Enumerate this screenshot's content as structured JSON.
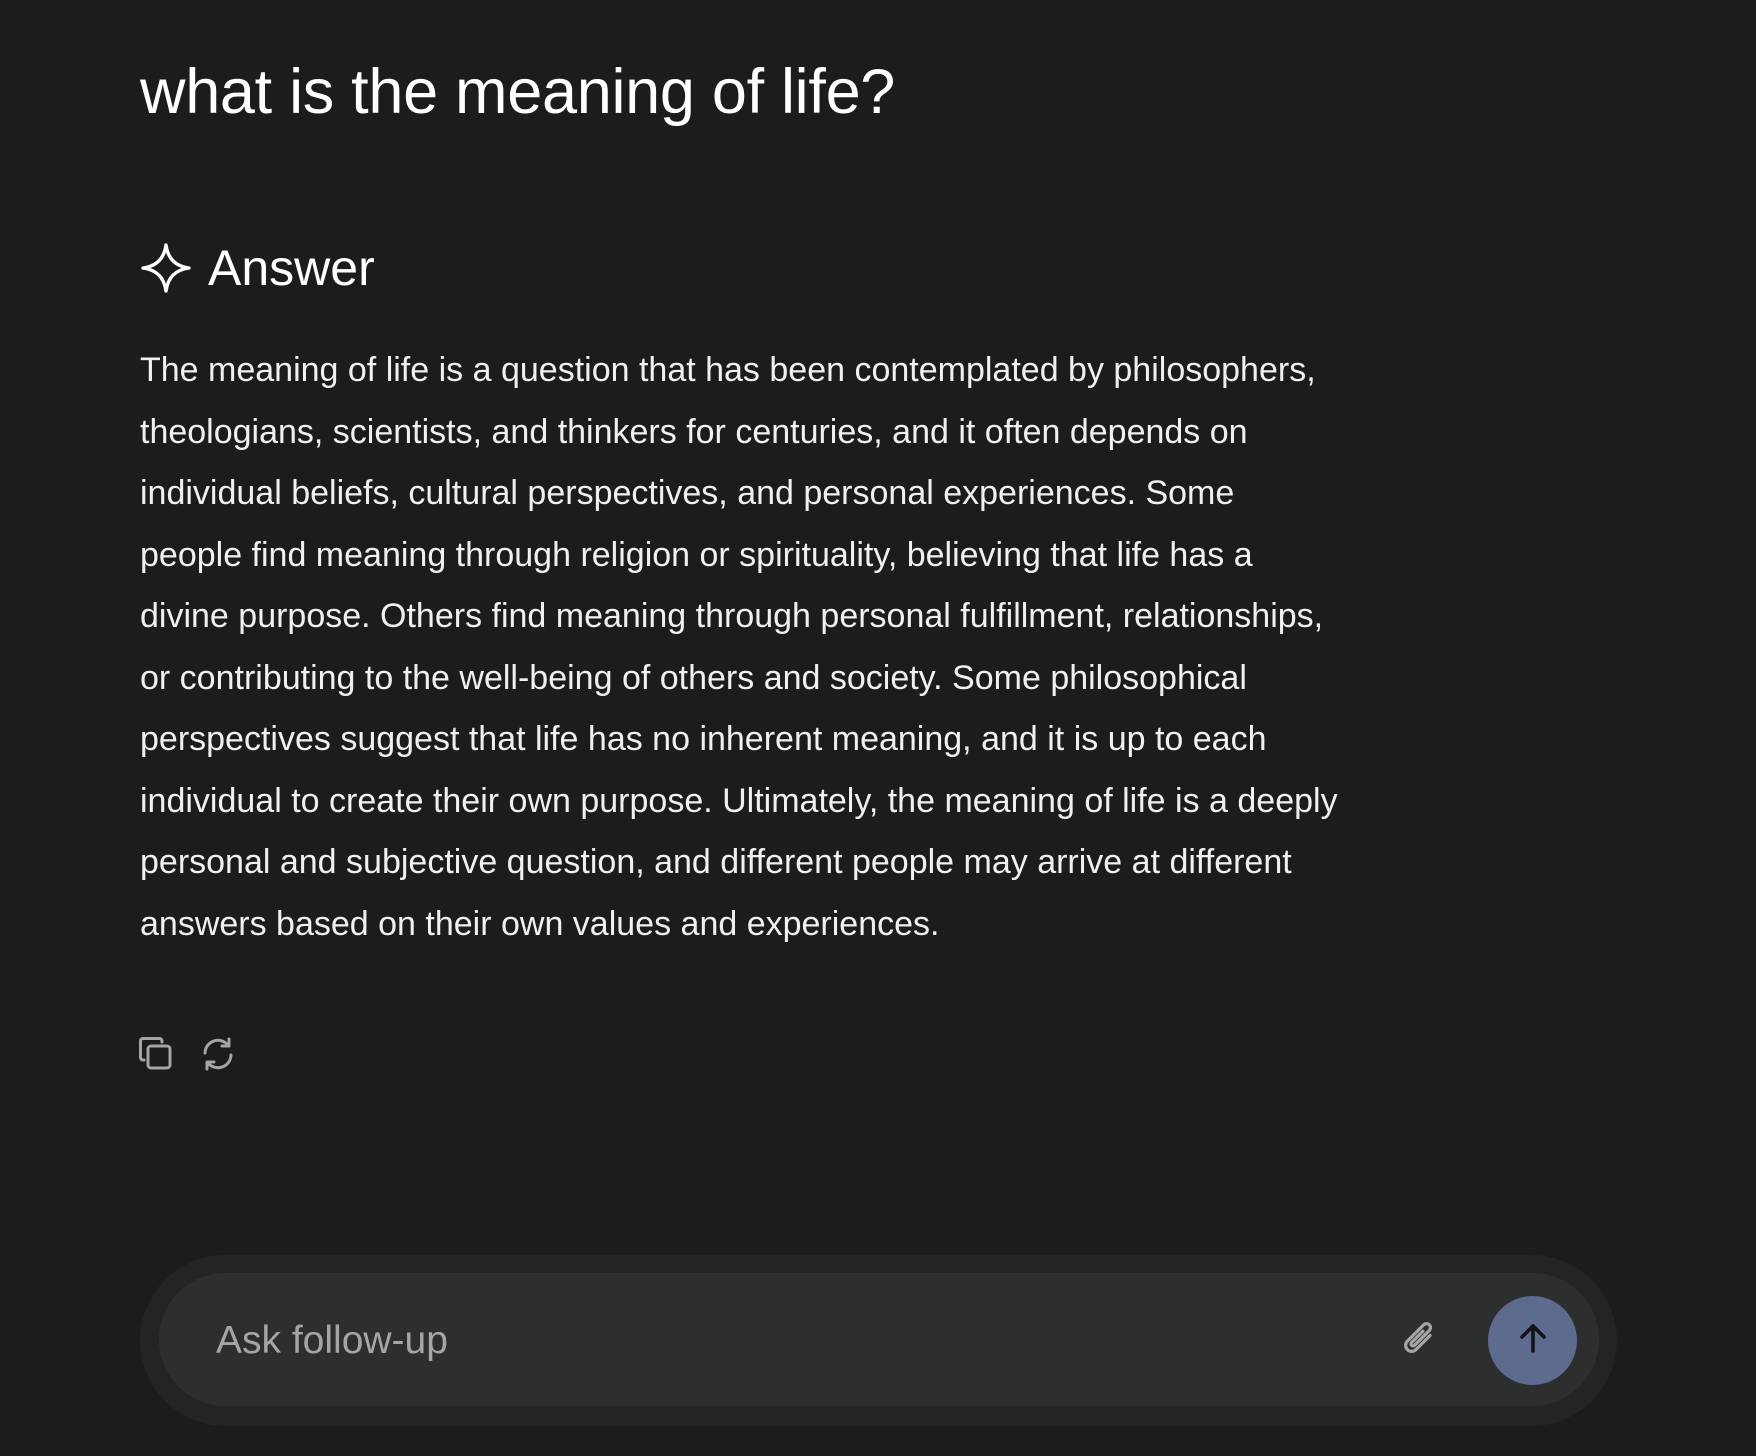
{
  "question": {
    "text": "what is the meaning of life?"
  },
  "answer": {
    "icon": "sparkle-icon",
    "heading": "Answer",
    "body": "The meaning of life is a question that has been contemplated by philosophers, theologians, scientists, and thinkers for centuries, and it often depends on individual beliefs, cultural perspectives, and personal experiences. Some people find meaning through religion or spirituality, believing that life has a divine purpose. Others find meaning through personal fulfillment, relationships, or contributing to the well-being of others and society. Some philosophical perspectives suggest that life has no inherent meaning, and it is up to each individual to create their own purpose. Ultimately, the meaning of life is a deeply personal and subjective question, and different people may arrive at different answers based on their own values and experiences.",
    "actions": [
      {
        "name": "copy",
        "icon": "copy-icon"
      },
      {
        "name": "regenerate",
        "icon": "refresh-icon"
      }
    ]
  },
  "composer": {
    "placeholder": "Ask follow-up",
    "value": "",
    "attach_icon": "paperclip-icon",
    "send_icon": "arrow-up-icon"
  },
  "colors": {
    "background": "#1b1c1c",
    "composer_outer": "#232525",
    "composer_inner": "#2d2f2f",
    "send_button": "#5d6b8f",
    "text": "#ffffff",
    "icon_muted": "#a3a6a6"
  }
}
